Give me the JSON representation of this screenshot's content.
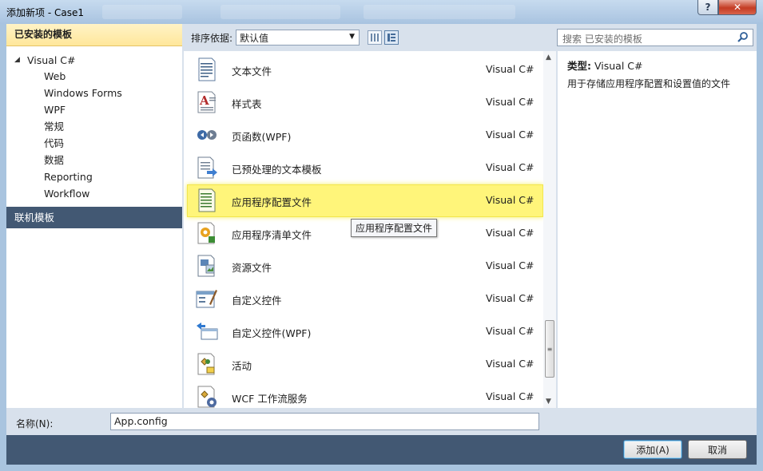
{
  "window": {
    "title": "添加新项 - Case1",
    "help": "?",
    "close": "✕"
  },
  "left_panel": {
    "header": "已安装的模板",
    "root": "Visual C#",
    "items": [
      "Web",
      "Windows Forms",
      "WPF",
      "常规",
      "代码",
      "数据",
      "Reporting",
      "Workflow"
    ],
    "online": "联机模板"
  },
  "toolbar": {
    "sort_label": "排序依据:",
    "sort_value": "默认值"
  },
  "search": {
    "placeholder": "搜索 已安装的模板"
  },
  "templates": [
    {
      "name": "文本文件",
      "lang": "Visual C#",
      "icon": "text-file-icon"
    },
    {
      "name": "样式表",
      "lang": "Visual C#",
      "icon": "stylesheet-icon"
    },
    {
      "name": "页函数(WPF)",
      "lang": "Visual C#",
      "icon": "page-function-icon"
    },
    {
      "name": "已预处理的文本模板",
      "lang": "Visual C#",
      "icon": "preprocessed-template-icon"
    },
    {
      "name": "应用程序配置文件",
      "lang": "Visual C#",
      "icon": "config-file-icon"
    },
    {
      "name": "应用程序清单文件",
      "lang": "Visual C#",
      "icon": "manifest-file-icon"
    },
    {
      "name": "资源文件",
      "lang": "Visual C#",
      "icon": "resource-file-icon"
    },
    {
      "name": "自定义控件",
      "lang": "Visual C#",
      "icon": "custom-control-icon"
    },
    {
      "name": "自定义控件(WPF)",
      "lang": "Visual C#",
      "icon": "custom-control-wpf-icon"
    },
    {
      "name": "活动",
      "lang": "Visual C#",
      "icon": "activity-icon"
    },
    {
      "name": "WCF 工作流服务",
      "lang": "Visual C#",
      "icon": "wcf-workflow-icon"
    }
  ],
  "tooltip": "应用程序配置文件",
  "details": {
    "type_label": "类型:",
    "type_value": "Visual C#",
    "description": "用于存储应用程序配置和设置值的文件"
  },
  "name_field": {
    "label": "名称(N):",
    "value": "App.config"
  },
  "buttons": {
    "add": "添加(A)",
    "cancel": "取消"
  },
  "colors": {
    "selection_highlight": "#fff57a",
    "header_gold": "#ffe79b",
    "dark_bar": "#425873"
  }
}
